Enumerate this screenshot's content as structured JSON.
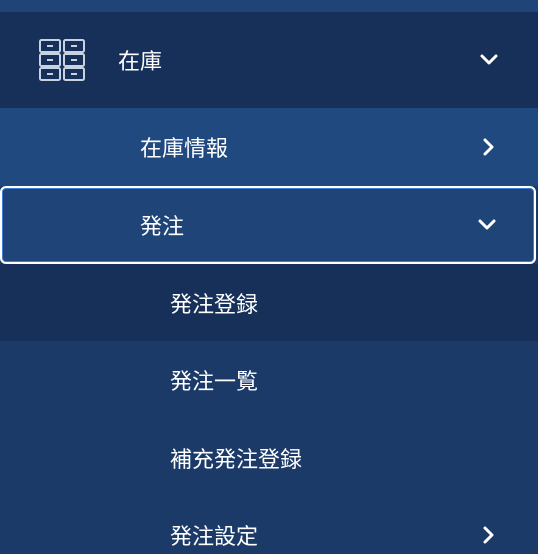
{
  "menu": {
    "inventory": {
      "label": "在庫",
      "icon": "inventory-grid-icon",
      "expanded": true
    },
    "stock_info": {
      "label": "在庫情報",
      "icon": "chevron-right-icon"
    },
    "order": {
      "label": "発注",
      "icon": "chevron-down-icon",
      "expanded": true,
      "selected": true
    },
    "order_items": [
      {
        "label": "発注登録"
      },
      {
        "label": "発注一覧"
      },
      {
        "label": "補充発注登録"
      },
      {
        "label": "発注設定",
        "icon": "chevron-right-icon"
      }
    ]
  },
  "colors": {
    "sidebar_bg": "#1b3a68",
    "header_bg": "#17305a",
    "submenu_bg": "#204a7f",
    "selected_border": "#ffffff",
    "text": "#ffffff"
  }
}
